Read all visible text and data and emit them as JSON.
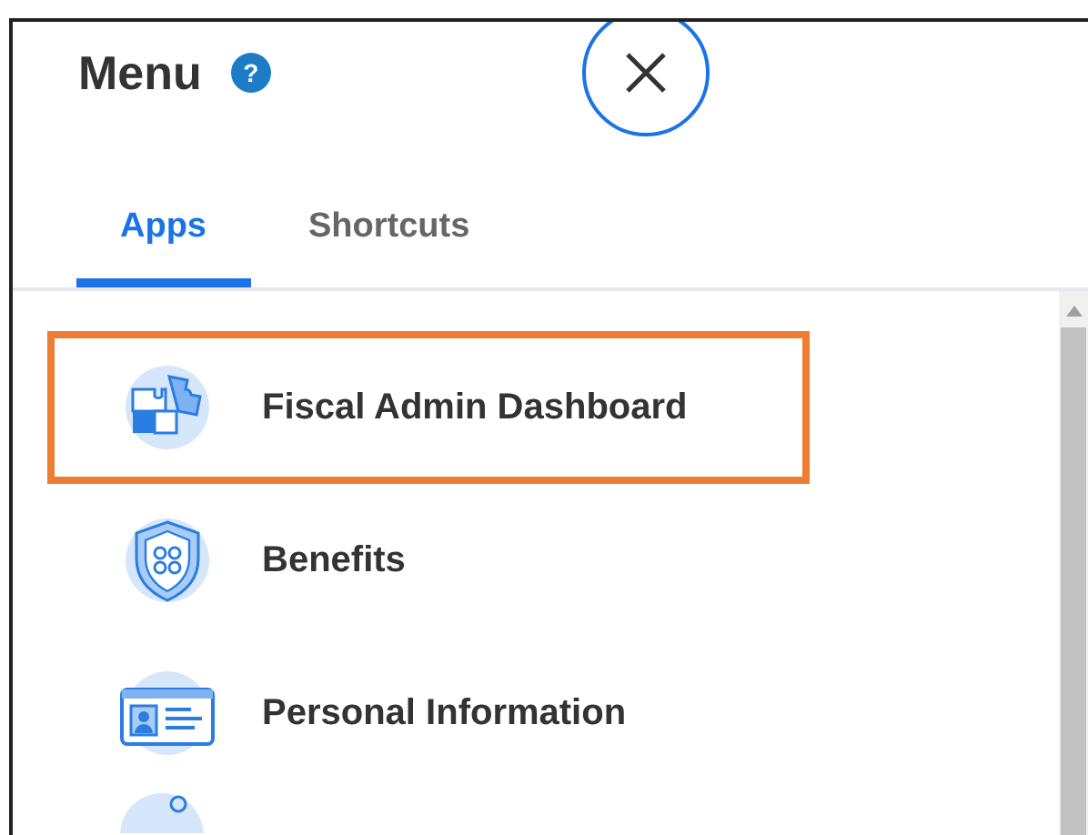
{
  "menu": {
    "title": "Menu",
    "help": "?"
  },
  "tabs": [
    {
      "label": "Apps",
      "selected": true
    },
    {
      "label": "Shortcuts",
      "selected": false
    }
  ],
  "apps": [
    {
      "label": "Fiscal Admin Dashboard",
      "highlighted": true
    },
    {
      "label": "Benefits",
      "highlighted": false
    },
    {
      "label": "Personal Information",
      "highlighted": false
    }
  ]
}
